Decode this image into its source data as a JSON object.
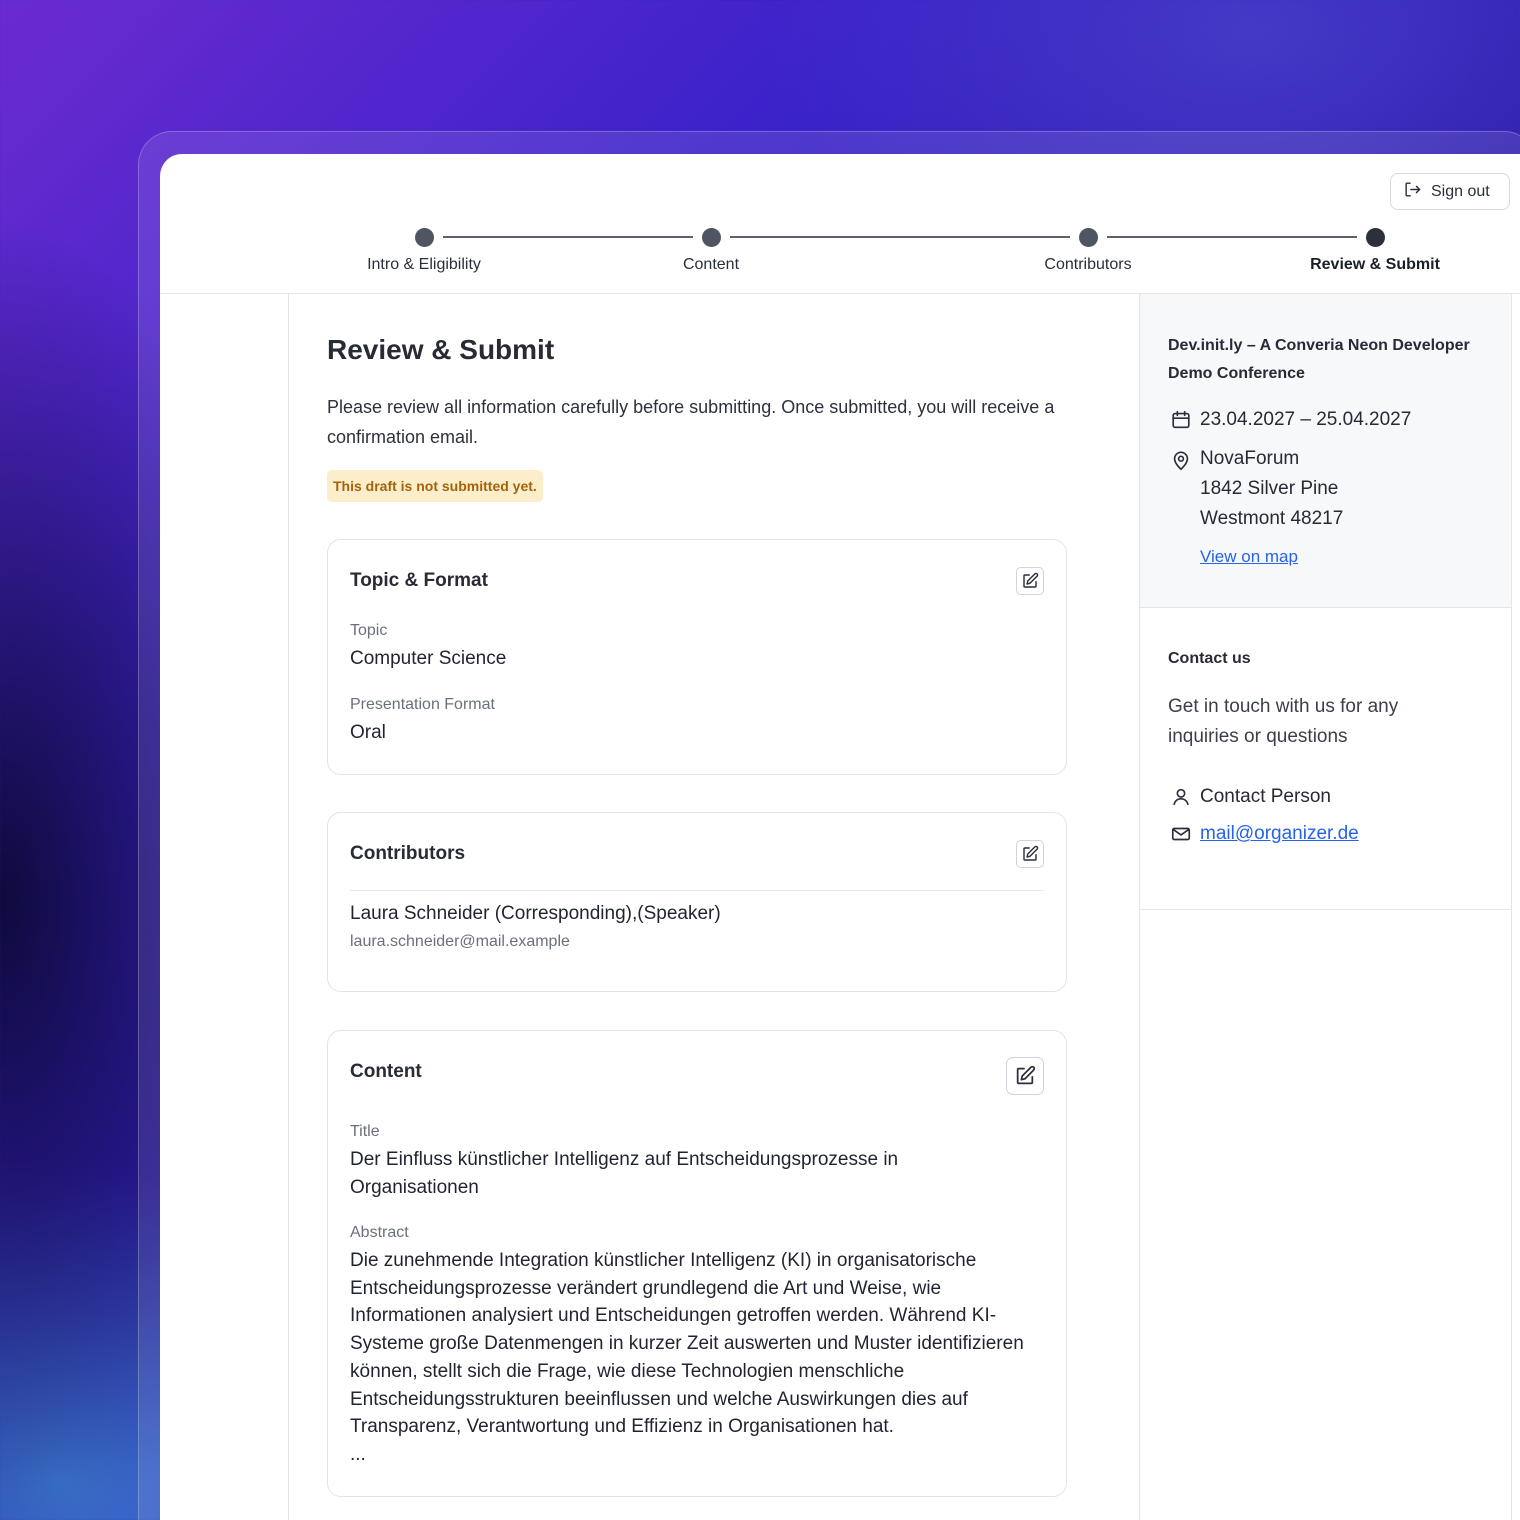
{
  "header": {
    "sign_out_label": "Sign out",
    "steps": [
      {
        "label": "Intro & Eligibility"
      },
      {
        "label": "Content"
      },
      {
        "label": "Contributors"
      },
      {
        "label": "Review & Submit"
      }
    ],
    "active_step": "Review & Submit"
  },
  "main": {
    "title": "Review & Submit",
    "intro": "Please review all information carefully before submitting. Once submitted, you will receive a confirmation email.",
    "status_badge": "This draft is not submitted yet.",
    "topic_card": {
      "title": "Topic & Format",
      "topic_label": "Topic",
      "topic_value": "Computer Science",
      "format_label": "Presentation Format",
      "format_value": "Oral"
    },
    "contributors_card": {
      "title": "Contributors",
      "name": "Laura Schneider (Corresponding),(Speaker)",
      "email": "laura.schneider@mail.example"
    },
    "content_card": {
      "title": "Content",
      "title_label": "Title",
      "title_value": "Der Einfluss künstlicher Intelligenz auf Entscheidungsprozesse in Organisationen",
      "abstract_label": "Abstract",
      "abstract_value": "Die zunehmende Integration künstlicher Intelligenz (KI) in organisatorische Entscheidungsprozesse verändert grundlegend die Art und Weise, wie Informationen analysiert und Entscheidungen getroffen werden. Während KI-Systeme große Datenmengen in kurzer Zeit auswerten und Muster identifizieren können, stellt sich die Frage, wie diese Technologien menschliche Entscheidungsstrukturen beeinflussen und welche Auswirkungen dies auf Transparenz, Verantwortung und Effizienz in Organisationen hat.",
      "ellipsis": "..."
    }
  },
  "sidebar": {
    "event_name": "Dev.init.ly – A Converia Neon Developer Demo Conference",
    "dates": "23.04.2027 – 25.04.2027",
    "venue_name": "NovaForum",
    "venue_street": "1842 Silver Pine",
    "venue_city": "Westmont 48217",
    "map_link": "View on map",
    "contact_title": "Contact us",
    "contact_desc": "Get in touch with us for any inquiries or questions",
    "contact_person": "Contact Person",
    "contact_email": "mail@organizer.de"
  },
  "colors": {
    "link": "#2563eb",
    "badge_bg": "#fdeecb",
    "badge_text": "#a3630a"
  },
  "icons": [
    "sign-out-icon",
    "edit-icon",
    "calendar-icon",
    "location-pin-icon",
    "person-icon",
    "mail-icon"
  ]
}
